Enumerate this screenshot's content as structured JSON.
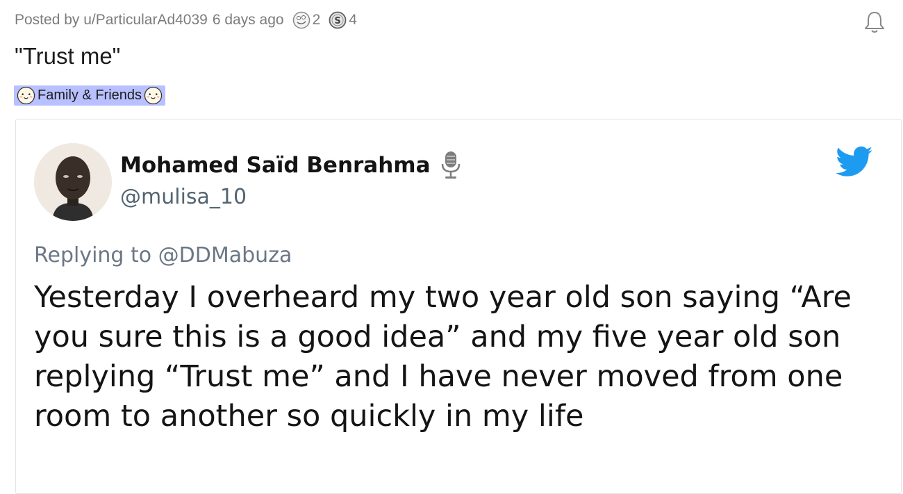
{
  "post": {
    "posted_by": "Posted by u/ParticularAd4039",
    "time_ago": "6 days ago",
    "awards": [
      {
        "icon": "silly-award-icon",
        "count": "2"
      },
      {
        "icon": "silver-coin-award-icon",
        "count": "4"
      }
    ],
    "title": "\"Trust me\"",
    "flair": {
      "label": "Family & Friends",
      "background": "#b8c0ff",
      "icon": "blushing-face-emoji-icon"
    }
  },
  "tweet": {
    "display_name": "Mohamed Saïd Benrahma",
    "handle": "@mulisa_10",
    "replying_to": "Replying to @DDMabuza",
    "text": "Yesterday I overheard my two year old son saying “Are you sure this is a good idea” and my five year old son replying “Trust me” and I have never moved from one room to another so quickly in my life",
    "brand_color": "#1d9bf0"
  }
}
